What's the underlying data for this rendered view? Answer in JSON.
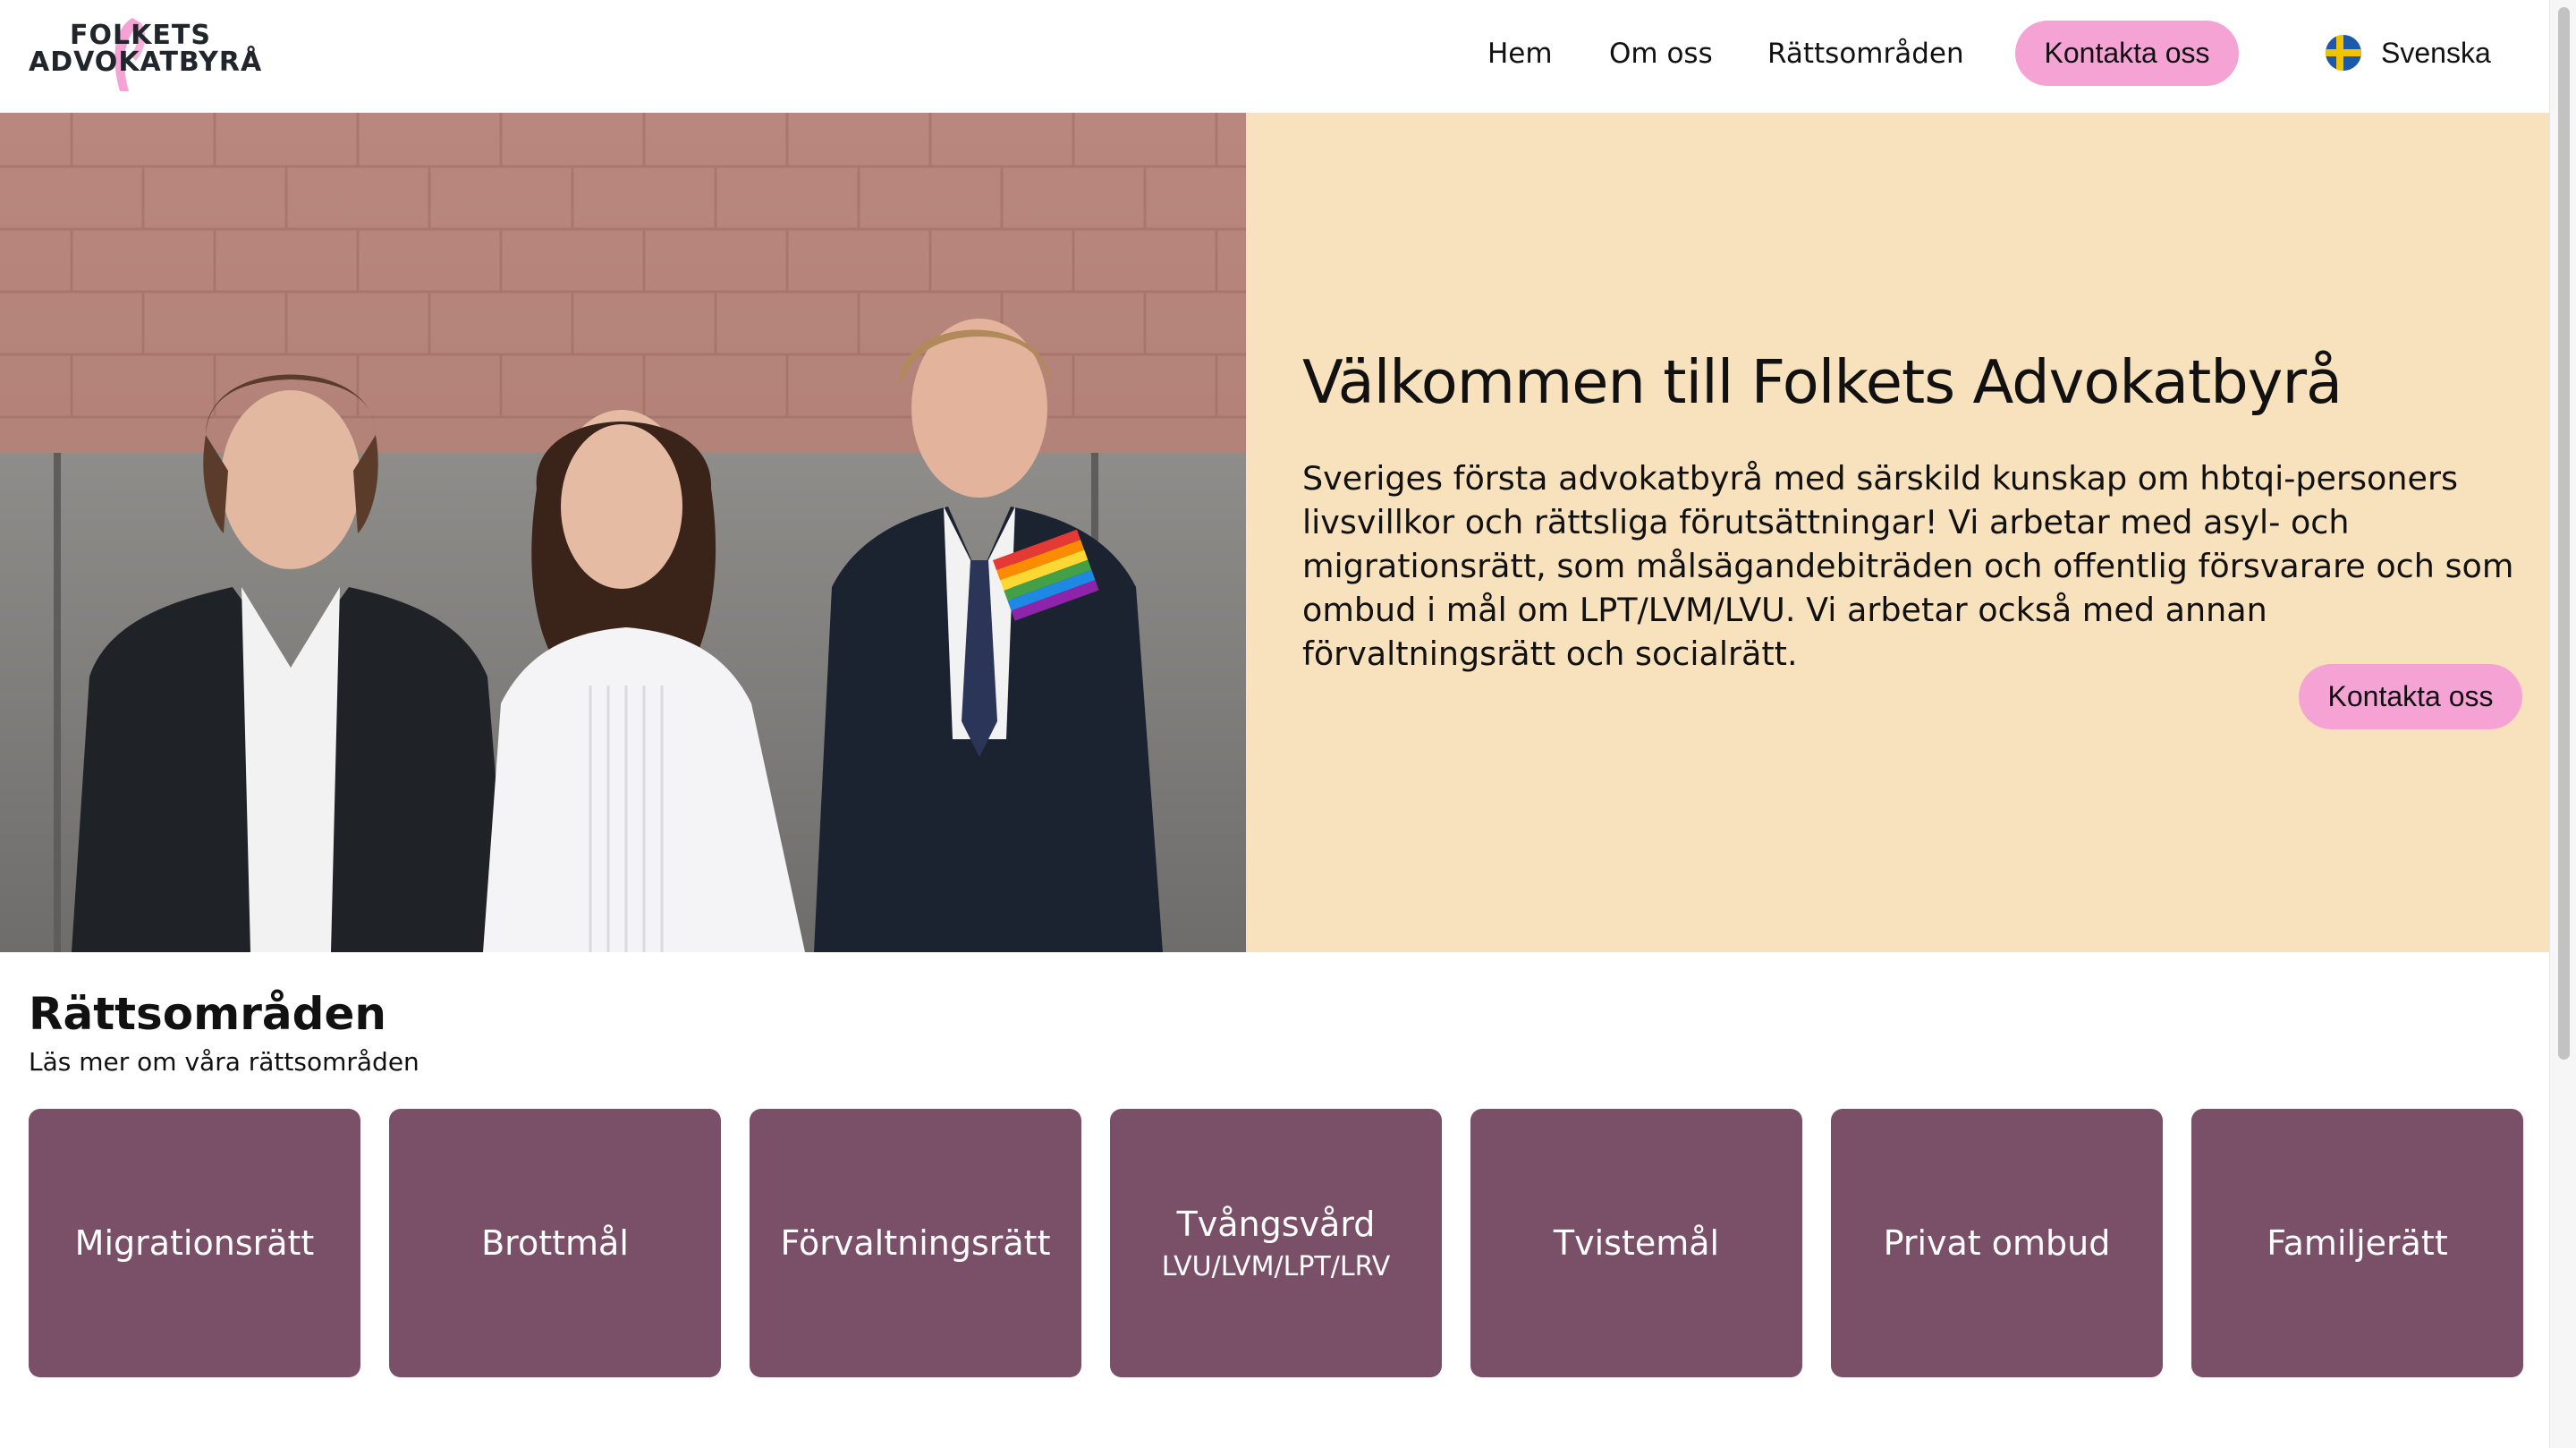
{
  "brand": {
    "logo_line1": "FOLKETS",
    "logo_line2": "ADVOKATBYRÅ",
    "accent_color": "#f5a3d4",
    "card_color": "#7a5068",
    "hero_panel_color": "#f8e1bd"
  },
  "nav": {
    "home": "Hem",
    "about": "Om oss",
    "areas": "Rättsområden",
    "contact": "Kontakta oss",
    "language": "Svenska",
    "language_flag_icon": "sweden-flag-icon"
  },
  "hero": {
    "title": "Välkommen till Folkets Advokatbyrå",
    "text": "Sveriges första advokatbyrå med särskild kunskap om hbtqi-personers livsvillkor och rättsliga förutsättningar! Vi arbetar med asyl- och migrationsrätt, som målsägandebiträden och offentlig försvarare och som ombud i mål om LPT/LVM/LVU. Vi arbetar också med annan förvaltningsrätt och socialrätt.",
    "cta": "Kontakta oss"
  },
  "areas": {
    "title": "Rättsområden",
    "subtitle": "Läs mer om våra rättsområden",
    "cards": [
      {
        "title": "Migrationsrätt",
        "sub": ""
      },
      {
        "title": "Brottmål",
        "sub": ""
      },
      {
        "title": "Förvaltningsrätt",
        "sub": ""
      },
      {
        "title": "Tvångsvård",
        "sub": "LVU/LVM/LPT/LRV"
      },
      {
        "title": "Tvistemål",
        "sub": ""
      },
      {
        "title": "Privat ombud",
        "sub": ""
      },
      {
        "title": "Familjerätt",
        "sub": ""
      }
    ]
  }
}
